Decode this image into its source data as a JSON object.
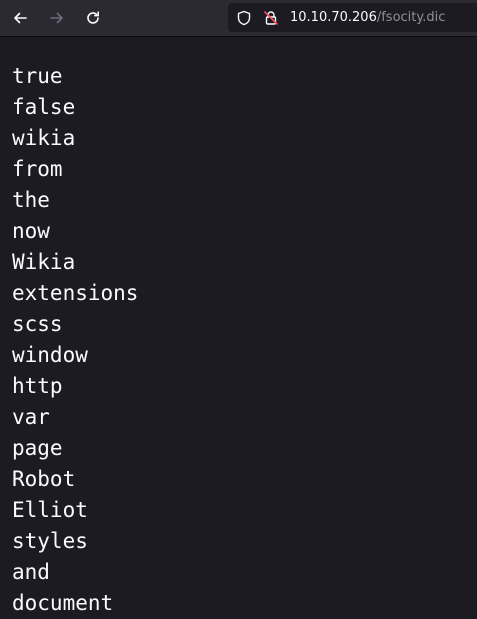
{
  "browser": {
    "url_host": "10.10.70.206",
    "url_path": "/fsocity.dic"
  },
  "content": {
    "lines": [
      "true",
      "false",
      "wikia",
      "from",
      "the",
      "now",
      "Wikia",
      "extensions",
      "scss",
      "window",
      "http",
      "var",
      "page",
      "Robot",
      "Elliot",
      "styles",
      "and",
      "document"
    ]
  }
}
